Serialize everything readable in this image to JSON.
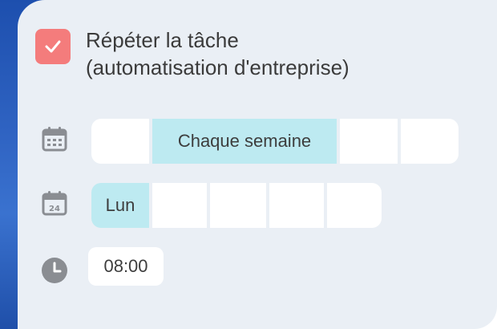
{
  "task": {
    "repeat_checked": true,
    "title_line1": "Répéter la tâche",
    "title_line2": "(automatisation d'entreprise)"
  },
  "frequency": {
    "icon": "calendar-icon",
    "selected_label": "Chaque semaine"
  },
  "weekday": {
    "icon": "calendar-date-icon",
    "icon_number": "24",
    "selected_label": "Lun"
  },
  "time": {
    "icon": "clock-icon",
    "value": "08:00"
  },
  "colors": {
    "checkbox": "#f47c7c",
    "selected_segment": "#bdeaf1",
    "panel": "#eaeff5",
    "icon_gray": "#8a8d92"
  }
}
